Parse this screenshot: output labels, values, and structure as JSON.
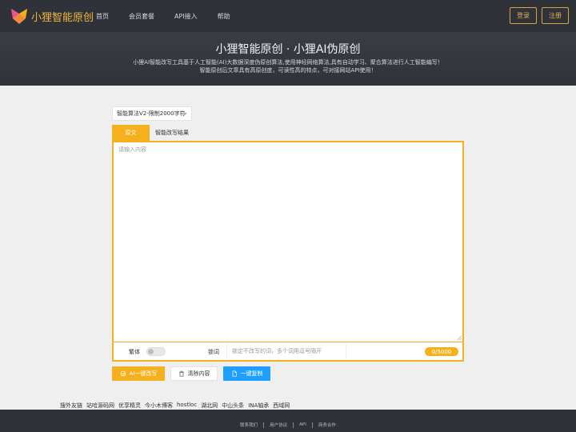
{
  "header": {
    "logo_text": "小狸智能原创",
    "nav": [
      "首页",
      "会员套餐",
      "API接入",
      "帮助"
    ],
    "login_label": "登录",
    "register_label": "注册"
  },
  "hero": {
    "title": "小狸智能原创 · 小狸AI伪原创",
    "desc_line1": "小狸AI智能改写工具基于人工智能(AI)大数据深度伪原创算法,使用神经网络算法,具有自动学习、聚合算法进行人工智能编写！",
    "desc_line2": "智能原创后文章具有高原创度，可读性高的特点，可对接网站API使用！"
  },
  "main": {
    "algorithm_select": "智能算法V2-限制2000字符",
    "tabs": [
      "原文",
      "智能改写结果"
    ],
    "textarea_placeholder": "请输入内容",
    "traditional_label": "繁体",
    "lock_label": "锁词",
    "lock_placeholder": "锁定不改写的词，多个词用逗号隔开",
    "counter": "0/5000",
    "buttons": {
      "ai_rewrite": "AI一键改写",
      "clear": "清除内容",
      "copy": "一键复制"
    }
  },
  "friend_links": [
    "搜外友链",
    "站哈源码网",
    "优享精灵",
    "今小木博客",
    "hostloc",
    "湖北网",
    "中山头条",
    "INA轴承",
    "西域网"
  ],
  "footer": {
    "links": [
      "联系我们",
      "用户协议",
      "API",
      "商务合作"
    ]
  },
  "colors": {
    "accent": "#f5b01e",
    "header_bg": "#2f3239",
    "copy_button": "#1e9fff"
  }
}
